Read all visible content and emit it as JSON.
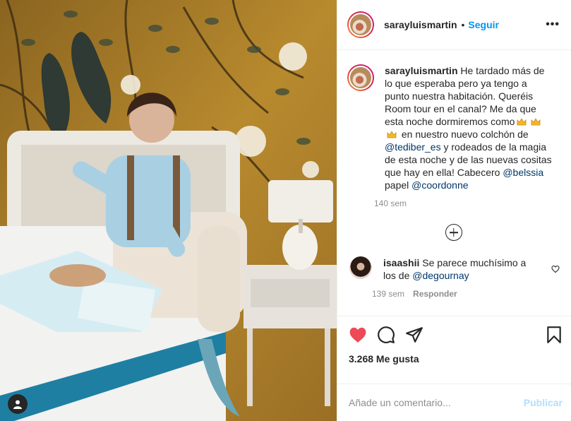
{
  "post": {
    "author": "sarayluismartin",
    "follow_label": "Seguir",
    "more_label": "•••",
    "separator": "•"
  },
  "caption": {
    "author": "sarayluismartin",
    "text_1": " He tardado más de lo que esperaba pero ya tengo a punto nuestra habitación. Queréis Room tour en el canal? Me da que esta noche dormiremos como",
    "text_2": " en nuestro nuevo colchón de ",
    "mention_1": "@tediber_es",
    "text_3": " y rodeados de la magia de esta noche y de las nuevas cositas que hay en ella! Cabecero ",
    "mention_2": "@belssia",
    "text_4": " papel ",
    "mention_3": "@coordonne",
    "crown_icons": [
      "crown-emoji",
      "crown-emoji",
      "crown-emoji"
    ],
    "time": "140 sem"
  },
  "comment": {
    "author": "isaashii",
    "text": " Se parece muchísimo a los de ",
    "mention": "@degournay",
    "time": "139 sem",
    "reply_label": "Responder"
  },
  "actions": {
    "likes": "3.268 Me gusta",
    "liked": true,
    "like_color": "#ed4956"
  },
  "composer": {
    "placeholder": "Añade un comentario...",
    "publish_label": "Publicar"
  },
  "colors": {
    "link": "#0095f6",
    "mention": "#00376b",
    "publish_disabled": "#b2dffc"
  }
}
